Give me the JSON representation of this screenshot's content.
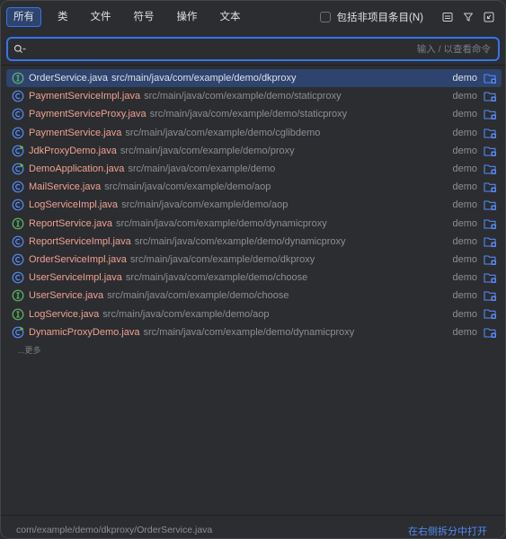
{
  "tabs": [
    {
      "label": "所有",
      "active": true
    },
    {
      "label": "类",
      "active": false
    },
    {
      "label": "文件",
      "active": false
    },
    {
      "label": "符号",
      "active": false
    },
    {
      "label": "操作",
      "active": false
    },
    {
      "label": "文本",
      "active": false
    }
  ],
  "options": {
    "include_non_project_label": "包括非项目条目(N)",
    "include_non_project_checked": false
  },
  "search": {
    "value": "",
    "hint": "输入 / 以查看命令"
  },
  "results": [
    {
      "name": "OrderService.java",
      "path": "src/main/java/com/example/demo/dkproxy",
      "module": "demo",
      "icon": "interface",
      "selected": true
    },
    {
      "name": "PaymentServiceImpl.java",
      "path": "src/main/java/com/example/demo/staticproxy",
      "module": "demo",
      "icon": "class",
      "selected": false
    },
    {
      "name": "PaymentServiceProxy.java",
      "path": "src/main/java/com/example/demo/staticproxy",
      "module": "demo",
      "icon": "class",
      "selected": false
    },
    {
      "name": "PaymentService.java",
      "path": "src/main/java/com/example/demo/cglibdemo",
      "module": "demo",
      "icon": "class",
      "selected": false
    },
    {
      "name": "JdkProxyDemo.java",
      "path": "src/main/java/com/example/demo/proxy",
      "module": "demo",
      "icon": "runnable-class",
      "selected": false
    },
    {
      "name": "DemoApplication.java",
      "path": "src/main/java/com/example/demo",
      "module": "demo",
      "icon": "runnable-class",
      "selected": false
    },
    {
      "name": "MailService.java",
      "path": "src/main/java/com/example/demo/aop",
      "module": "demo",
      "icon": "class",
      "selected": false
    },
    {
      "name": "LogServiceImpl.java",
      "path": "src/main/java/com/example/demo/aop",
      "module": "demo",
      "icon": "class",
      "selected": false
    },
    {
      "name": "ReportService.java",
      "path": "src/main/java/com/example/demo/dynamicproxy",
      "module": "demo",
      "icon": "interface",
      "selected": false
    },
    {
      "name": "ReportServiceImpl.java",
      "path": "src/main/java/com/example/demo/dynamicproxy",
      "module": "demo",
      "icon": "class",
      "selected": false
    },
    {
      "name": "OrderServiceImpl.java",
      "path": "src/main/java/com/example/demo/dkproxy",
      "module": "demo",
      "icon": "class",
      "selected": false
    },
    {
      "name": "UserServiceImpl.java",
      "path": "src/main/java/com/example/demo/choose",
      "module": "demo",
      "icon": "class",
      "selected": false
    },
    {
      "name": "UserService.java",
      "path": "src/main/java/com/example/demo/choose",
      "module": "demo",
      "icon": "interface",
      "selected": false
    },
    {
      "name": "LogService.java",
      "path": "src/main/java/com/example/demo/aop",
      "module": "demo",
      "icon": "interface",
      "selected": false
    },
    {
      "name": "DynamicProxyDemo.java",
      "path": "src/main/java/com/example/demo/dynamicproxy",
      "module": "demo",
      "icon": "runnable-class",
      "selected": false
    }
  ],
  "more_label": "...更多",
  "footer": {
    "path": "com/example/demo/dkproxy/OrderService.java",
    "open_split_label": "在右侧拆分中打开"
  },
  "colors": {
    "accent": "#3574f0",
    "selection": "#2e436e",
    "filename_highlight": "#f0a191",
    "interface_icon": "#5fb865",
    "class_icon": "#548af7",
    "link": "#548af7"
  }
}
